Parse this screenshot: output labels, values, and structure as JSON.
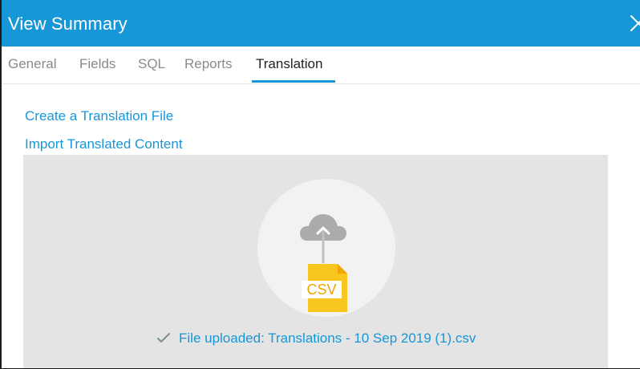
{
  "window": {
    "title": "View Summary",
    "close_icon": "close-icon",
    "accent_color": "#1796d8"
  },
  "tabs": [
    {
      "label": "General",
      "active": false
    },
    {
      "label": "Fields",
      "active": false
    },
    {
      "label": "SQL",
      "active": false
    },
    {
      "label": "Reports",
      "active": false
    },
    {
      "label": "Translation",
      "active": true
    }
  ],
  "links": {
    "create_translation": "Create a Translation File",
    "import_translated": "Import Translated Content"
  },
  "upload": {
    "icons": [
      "cloud-upload-icon",
      "csv-file-icon"
    ],
    "file_badge": "CSV",
    "status_icon": "check-icon",
    "status_text": "File uploaded: Translations - 10 Sep 2019 (1).csv"
  }
}
